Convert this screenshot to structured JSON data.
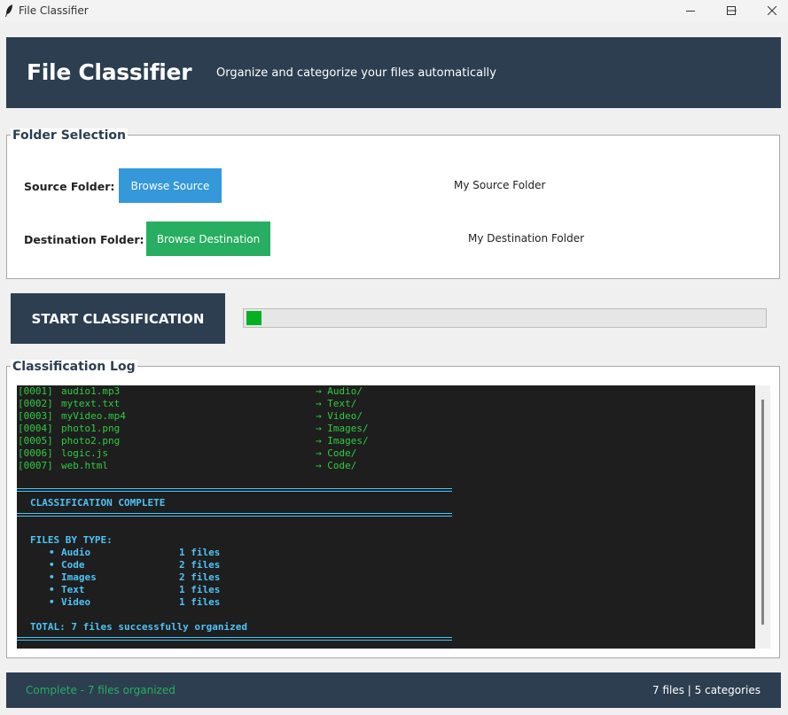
{
  "window": {
    "title": "File Classifier",
    "icon": "feather-icon"
  },
  "header": {
    "title": "File Classifier",
    "subtitle": "Organize and categorize your files automatically"
  },
  "folder_selection": {
    "group_title": "Folder Selection",
    "source": {
      "label": "Source Folder:",
      "button": "Browse Source",
      "path": "My Source Folder"
    },
    "destination": {
      "label": "Destination Folder:",
      "button": "Browse Destination",
      "path": "My Destination Folder"
    }
  },
  "actions": {
    "start_label": "START CLASSIFICATION",
    "progress_fraction": 0.03
  },
  "log": {
    "group_title": "Classification Log",
    "entries": [
      {
        "id": "[0001]",
        "file": "audio1.mp3",
        "dest": "→ Audio/"
      },
      {
        "id": "[0002]",
        "file": "mytext.txt",
        "dest": "→ Text/"
      },
      {
        "id": "[0003]",
        "file": "myVideo.mp4",
        "dest": "→ Video/"
      },
      {
        "id": "[0004]",
        "file": "photo1.png",
        "dest": "→ Images/"
      },
      {
        "id": "[0005]",
        "file": "photo2.png",
        "dest": "→ Images/"
      },
      {
        "id": "[0006]",
        "file": "logic.js",
        "dest": "→ Code/"
      },
      {
        "id": "[0007]",
        "file": "web.html",
        "dest": "→ Code/"
      }
    ],
    "complete_text": "CLASSIFICATION COMPLETE",
    "by_type_title": "FILES BY TYPE:",
    "by_type": [
      {
        "type": "Audio",
        "count": "1 files"
      },
      {
        "type": "Code",
        "count": "2 files"
      },
      {
        "type": "Images",
        "count": "2 files"
      },
      {
        "type": "Text",
        "count": "1 files"
      },
      {
        "type": "Video",
        "count": "1 files"
      }
    ],
    "total_text": "TOTAL: 7 files successfully organized"
  },
  "status": {
    "message": "Complete - 7 files organized",
    "stats": "7 files | 5 categories"
  },
  "colors": {
    "header_bg": "#2c3e50",
    "source_button": "#3498db",
    "destination_button": "#27ae60",
    "progress_fill": "#06b025",
    "log_bg": "#1e1e1e",
    "log_green": "#2ecc40",
    "log_cyan": "#4fc3f7",
    "status_green": "#27ae60"
  }
}
